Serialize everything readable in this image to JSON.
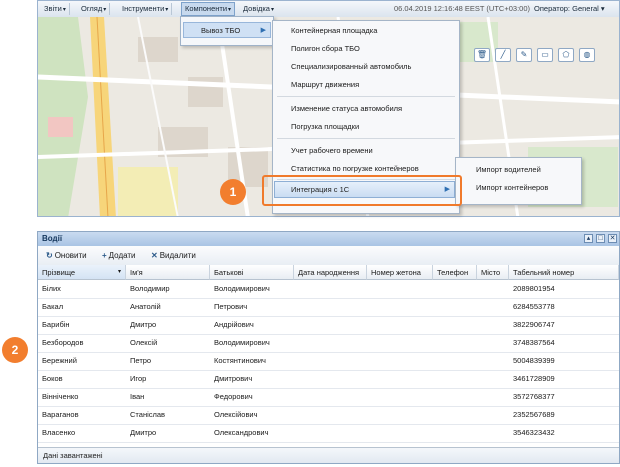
{
  "menubar": {
    "items": [
      {
        "label": "Звіти"
      },
      {
        "label": "Огляд"
      },
      {
        "label": "Інструменти"
      },
      {
        "label": "Компоненти"
      },
      {
        "label": "Довідка"
      }
    ],
    "datetime": "06.04.2019 12:16:48 EEST (UTC+03:00)",
    "operator": "Оператор: General"
  },
  "components_menu": {
    "item": "Вывоз ТБО"
  },
  "tbo_menu": {
    "items": [
      "Контейнерная площадка",
      "Полигон сбора ТБО",
      "Специализированный автомобиль",
      "Маршрут движения",
      "Изменение статуса автомобиля",
      "Погрузка площадки",
      "Учет рабочего времени",
      "Статистика по погрузке контейнеров"
    ],
    "integration": "Интеграция с 1С"
  },
  "integration_menu": {
    "items": [
      "Импорт водителей",
      "Импорт контейнеров"
    ]
  },
  "callouts": [
    "1",
    "2"
  ],
  "drivers": {
    "title": "Водії",
    "toolbar": {
      "refresh": "Оновити",
      "add": "Додати",
      "delete": "Видалити"
    },
    "columns": [
      "Прізвище",
      "Ім'я",
      "Батькові",
      "Дата народження",
      "Номер жетона",
      "Телефон",
      "Місто",
      "Табельний номер"
    ],
    "rows": [
      [
        "Білих",
        "Володимир",
        "Володимирович",
        "",
        "",
        "",
        "",
        "2089801954"
      ],
      [
        "Бакал",
        "Анатолій",
        "Петрович",
        "",
        "",
        "",
        "",
        "6284553778"
      ],
      [
        "Барибін",
        "Дмитро",
        "Андрійович",
        "",
        "",
        "",
        "",
        "3822906747"
      ],
      [
        "Безбородов",
        "Олексій",
        "Володимирович",
        "",
        "",
        "",
        "",
        "3748387564"
      ],
      [
        "Бережний",
        "Петро",
        "Костянтинович",
        "",
        "",
        "",
        "",
        "5004839399"
      ],
      [
        "Боков",
        "Игор",
        "Дмитрович",
        "",
        "",
        "",
        "",
        "3461728909"
      ],
      [
        "Вінніченко",
        "Іван",
        "Федорович",
        "",
        "",
        "",
        "",
        "3572768377"
      ],
      [
        "Вараганов",
        "Станіслав",
        "Олексійович",
        "",
        "",
        "",
        "",
        "2352567689"
      ],
      [
        "Власенко",
        "Дмитро",
        "Олександрович",
        "",
        "",
        "",
        "",
        "3546323432"
      ]
    ],
    "status": "Дані завантажені"
  },
  "colors": {
    "accent": "#f27e2e",
    "titlebar": "#a9c4e4",
    "selection": "#cfe0f4"
  }
}
